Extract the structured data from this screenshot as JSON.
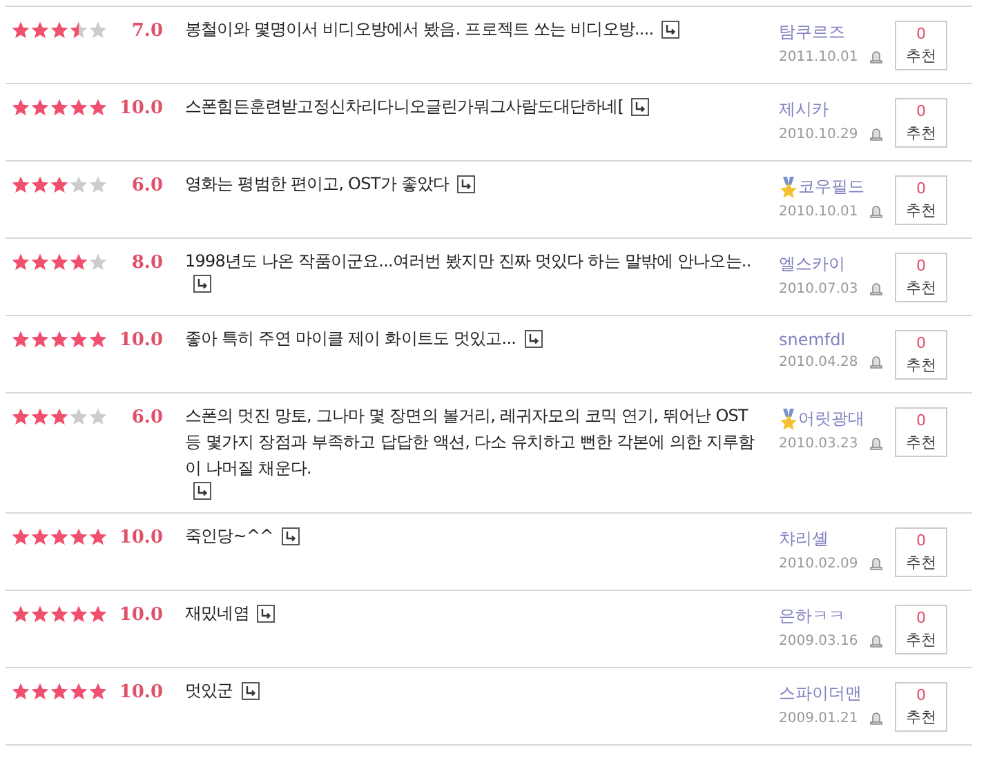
{
  "reviews": [
    {
      "stars": 3.5,
      "score": "7.0",
      "comment": "봉철이와 몇명이서 비디오방에서 봤음. 프로젝트 쏘는 비디오방....",
      "user": "탐쿠르즈",
      "badge": false,
      "date": "2011.10.01",
      "votes": "0",
      "vote_label": "추천"
    },
    {
      "stars": 5,
      "score": "10.0",
      "comment": "스폰힘든훈련받고정신차리다니오글린가뭐그사람도대단하네[",
      "user": "제시카",
      "badge": false,
      "date": "2010.10.29",
      "votes": "0",
      "vote_label": "추천"
    },
    {
      "stars": 3,
      "score": "6.0",
      "comment": "영화는 평범한 편이고, OST가 좋았다",
      "user": "코우필드",
      "badge": true,
      "date": "2010.10.01",
      "votes": "0",
      "vote_label": "추천"
    },
    {
      "stars": 4,
      "score": "8.0",
      "comment": "1998년도 나온 작품이군요...여러번 봤지만 진짜 멋있다 하는 말밖에 안나오는..",
      "user": "엘스카이",
      "badge": false,
      "date": "2010.07.03",
      "votes": "0",
      "vote_label": "추천"
    },
    {
      "stars": 5,
      "score": "10.0",
      "comment": "좋아 특히 주연 마이클 제이 화이트도 멋있고...",
      "user": "snemfdl",
      "badge": false,
      "date": "2010.04.28",
      "votes": "0",
      "vote_label": "추천"
    },
    {
      "stars": 3,
      "score": "6.0",
      "comment": "스폰의 멋진 망토, 그나마 몇 장면의 볼거리, 레귀자모의 코믹 연기, 뛰어난 OST 등 몇가지 장점과 부족하고 답답한 액션, 다소 유치하고 뻔한 각본에 의한 지루함이 나머질 채운다.",
      "user": "어릿광대",
      "badge": true,
      "date": "2010.03.23",
      "votes": "0",
      "vote_label": "추천"
    },
    {
      "stars": 5,
      "score": "10.0",
      "comment": "죽인당~^^",
      "user": "챠리셸",
      "badge": false,
      "date": "2010.02.09",
      "votes": "0",
      "vote_label": "추천"
    },
    {
      "stars": 5,
      "score": "10.0",
      "comment": "재밌네염",
      "user": "은하ㅋㅋ",
      "badge": false,
      "date": "2009.03.16",
      "votes": "0",
      "vote_label": "추천"
    },
    {
      "stars": 5,
      "score": "10.0",
      "comment": "멋있군",
      "user": "스파이더맨",
      "badge": false,
      "date": "2009.01.21",
      "votes": "0",
      "vote_label": "추천"
    }
  ]
}
